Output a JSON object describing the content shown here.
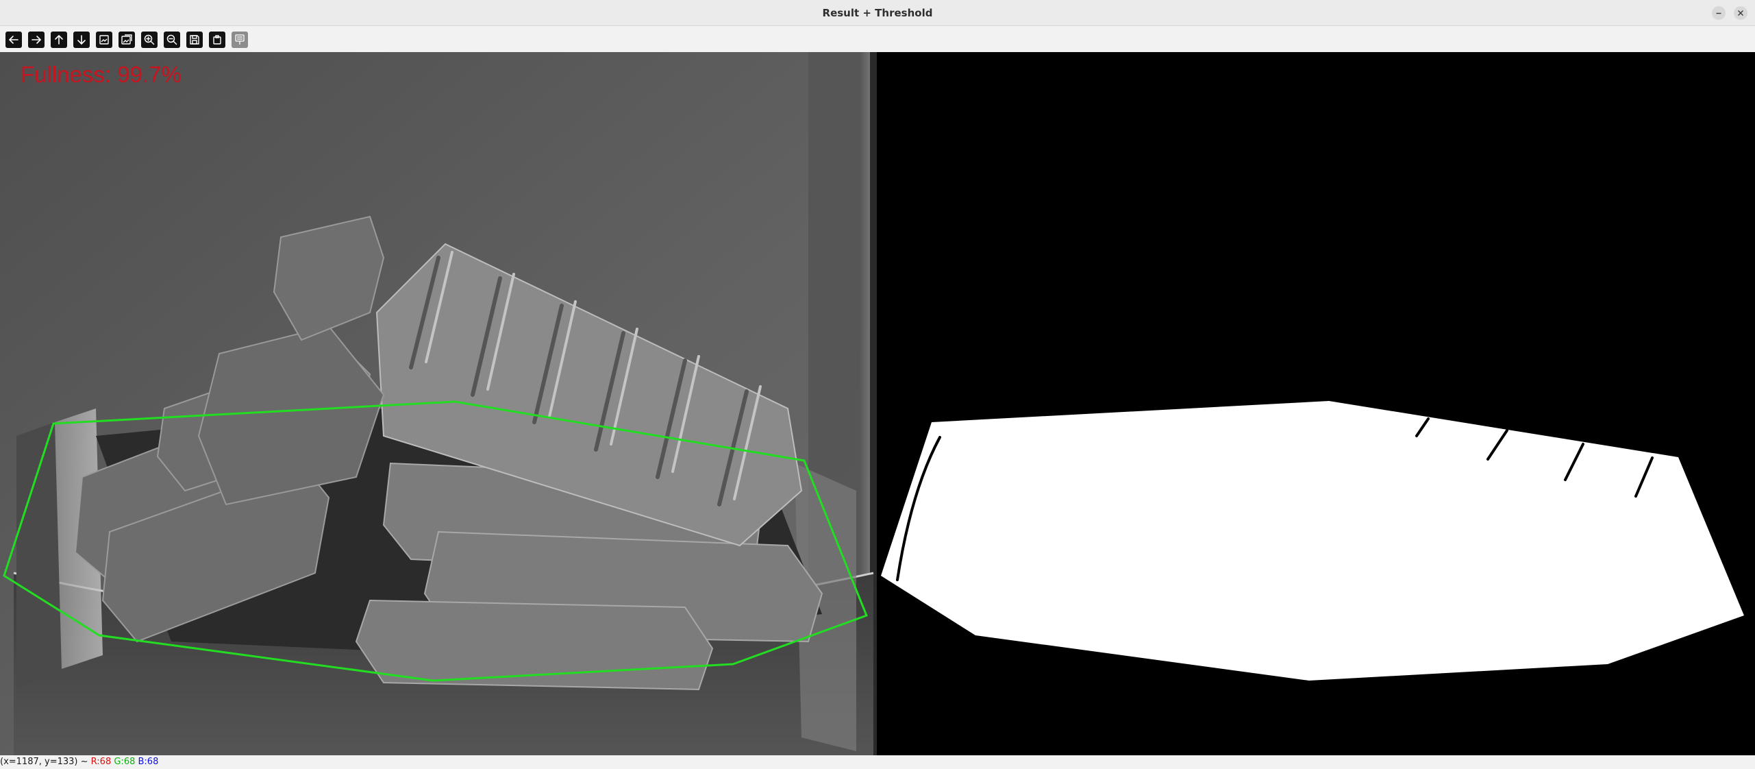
{
  "window": {
    "title": "Result + Threshold"
  },
  "toolbar": {
    "buttons": [
      {
        "icon": "arrow-left-icon",
        "name": "pan-left-button",
        "enabled": true
      },
      {
        "icon": "arrow-right-icon",
        "name": "pan-right-button",
        "enabled": true
      },
      {
        "icon": "arrow-up-icon",
        "name": "pan-up-button",
        "enabled": true
      },
      {
        "icon": "arrow-down-icon",
        "name": "pan-down-button",
        "enabled": true
      },
      {
        "icon": "zoom-fit-icon",
        "name": "zoom-fit-button",
        "enabled": true
      },
      {
        "icon": "zoom-original-icon",
        "name": "zoom-original-button",
        "enabled": true
      },
      {
        "icon": "zoom-in-icon",
        "name": "zoom-in-button",
        "enabled": true
      },
      {
        "icon": "zoom-out-icon",
        "name": "zoom-out-button",
        "enabled": true
      },
      {
        "icon": "save-icon",
        "name": "save-button",
        "enabled": true
      },
      {
        "icon": "copy-icon",
        "name": "copy-button",
        "enabled": true
      },
      {
        "icon": "properties-icon",
        "name": "properties-button",
        "enabled": false
      }
    ]
  },
  "overlay": {
    "fullness_label": "Fullness: 99.7%",
    "fullness_color": "#c8141e",
    "hull_color": "#22dd22"
  },
  "status": {
    "coords": "(x=1187, y=133) ~",
    "r": "R:68",
    "g": "G:68",
    "b": "B:68",
    "r_color": "#e01010",
    "g_color": "#10b010",
    "b_color": "#1010e0"
  }
}
